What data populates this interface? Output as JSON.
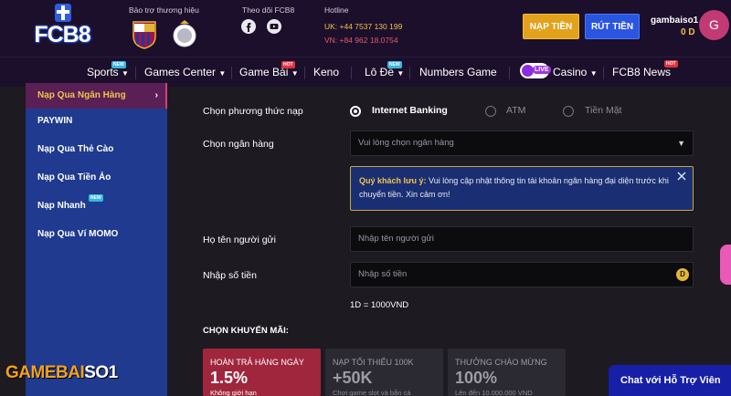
{
  "header": {
    "logo_text": "FCB8",
    "sponsor_label": "Bảo trợ thương hiệu",
    "follow_label": "Theo dõi FCB8",
    "hotline_label": "Hotline",
    "hotline_uk": "UK: +44 7537 130 199",
    "hotline_vn": "VN: +84 962 18.0754",
    "deposit_button": "NẠP TIỀN",
    "withdraw_button": "RÚT TIỀN",
    "username": "gambaiso1",
    "balance": "0 D",
    "avatar_letter": "G",
    "colors": {
      "deposit": "#e2a21c",
      "withdraw": "#2a55e0",
      "avatar": "#c23a74"
    }
  },
  "nav": {
    "items": [
      {
        "label": "Sports",
        "badge": "NEW"
      },
      {
        "label": "Games Center"
      },
      {
        "label": "Game Bài",
        "badge": "HOT"
      },
      {
        "label": "Keno"
      },
      {
        "label": "Lô Đề",
        "badge": "NEW"
      },
      {
        "label": "Numbers Game"
      },
      {
        "label": "Casino",
        "live": "LIVE"
      },
      {
        "label": "FCB8 News",
        "badge": "HOT"
      }
    ]
  },
  "sidebar": {
    "items": [
      {
        "label": "Nạp Qua Ngân Hàng"
      },
      {
        "label": "PAYWIN"
      },
      {
        "label": "Nạp Qua Thẻ Cào"
      },
      {
        "label": "Nạp Qua Tiền Ảo"
      },
      {
        "label": "Nạp Nhanh",
        "badge": "NEW"
      },
      {
        "label": "Nạp Qua Ví MOMO"
      }
    ]
  },
  "form": {
    "method_label": "Chọn phương thức nạp",
    "methods": [
      "Internet Banking",
      "ATM",
      "Tiền Mặt"
    ],
    "selected_method": "Internet Banking",
    "bank_label": "Chọn ngân hàng",
    "bank_placeholder": "Vui lòng chọn ngân hàng",
    "notice_bold": "Quý khách lưu ý:",
    "notice_text": " Vui lòng cập nhật thông tin tài khoản ngân hàng đại diện trước khi chuyển tiền. Xin cảm ơn!",
    "sender_label": "Họ tên người gửi",
    "sender_placeholder": "Nhập tên người gửi",
    "amount_label": "Nhập số tiền",
    "amount_placeholder": "Nhập số tiền",
    "coin_symbol": "D",
    "rate": "1D = 1000VND"
  },
  "promotions": {
    "title": "CHỌN KHUYẾN MÃI:",
    "items": [
      {
        "head": "HOÀN TRẢ HÀNG NGÀY",
        "value": "1.5%",
        "sub": "Không giới hạn"
      },
      {
        "head": "NẠP TỐI THIỂU 100K",
        "value": "+50K",
        "sub": "Chơi game slot và bắn cá"
      },
      {
        "head": "THƯỞNG CHÀO MỪNG",
        "value": "100%",
        "sub": "Lên đến 10.000.000 VND"
      }
    ]
  },
  "chat": {
    "label": "Chat với Hỗ Trợ Viên"
  },
  "watermark": {
    "part1": "GAMEBAI",
    "part2": "SO1"
  }
}
